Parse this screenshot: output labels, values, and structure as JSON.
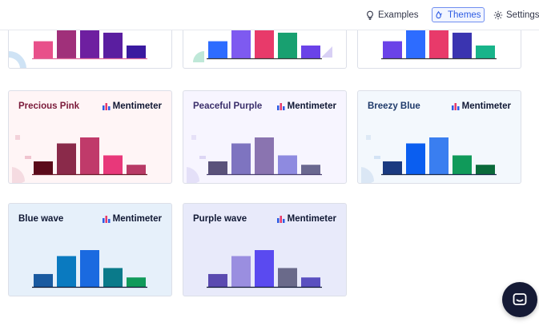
{
  "nav": {
    "examples_label": "Examples",
    "themes_label": "Themes",
    "settings_label": "Settings"
  },
  "brand_label": "Mentimeter",
  "colors": {
    "active_accent": "#2d5be3",
    "chat_button": "#151a35"
  },
  "themes": [
    {
      "id": "partial-1",
      "name": "",
      "bg": "#ffffff",
      "name_color": "#101834",
      "base_color": "#e06a9a",
      "bar_values": [
        2,
        6,
        6,
        3,
        1.5
      ],
      "bar_colors": [
        "#e8508a",
        "#a0307a",
        "#6e1fa0",
        "#5a1ea0",
        "#3a1aa0"
      ],
      "partial": true
    },
    {
      "id": "partial-2",
      "name": "",
      "bg": "#ffffff",
      "name_color": "#101834",
      "base_color": "#3a3a3a",
      "bar_values": [
        2,
        6,
        6,
        3,
        1.5
      ],
      "bar_colors": [
        "#2d6cff",
        "#7e5af0",
        "#e83a6a",
        "#18a070",
        "#6a42e8"
      ],
      "partial": true
    },
    {
      "id": "partial-3",
      "name": "",
      "bg": "#ffffff",
      "name_color": "#101834",
      "base_color": "#3a3a3a",
      "bar_values": [
        2,
        5.5,
        5.5,
        3,
        1.5
      ],
      "bar_colors": [
        "#6a42e8",
        "#2d6cff",
        "#e83a6a",
        "#3a34b0",
        "#18b48a"
      ],
      "partial": true
    },
    {
      "id": "precious-pink",
      "name": "Precious Pink",
      "bg": "#fff5f6",
      "name_color": "#7a1a3a",
      "base_color": "#6a1a2a",
      "bar_values": [
        1.5,
        3.6,
        4.3,
        2.2,
        1.1
      ],
      "bar_colors": [
        "#5a0a1a",
        "#8a2a4a",
        "#c03a6a",
        "#e8387a",
        "#b83a66"
      ]
    },
    {
      "id": "peaceful-purple",
      "name": "Peaceful Purple",
      "bg": "#f7f5ff",
      "name_color": "#3a2e6a",
      "base_color": "#4a4070",
      "bar_values": [
        1.5,
        3.6,
        4.3,
        2.2,
        1.1
      ],
      "bar_colors": [
        "#5a527a",
        "#7e74c0",
        "#8a74b0",
        "#8e8ae0",
        "#6a6890"
      ]
    },
    {
      "id": "breezy-blue",
      "name": "Breezy Blue",
      "bg": "#f3f8fd",
      "name_color": "#1f3a6a",
      "base_color": "#1a2a4a",
      "bar_values": [
        1.5,
        3.6,
        4.3,
        2.2,
        1.1
      ],
      "bar_colors": [
        "#1a3a80",
        "#0a5ef0",
        "#3a7ef0",
        "#109a5a",
        "#0a6a3a"
      ]
    },
    {
      "id": "blue-wave",
      "name": "Blue wave",
      "bg": "#e6f0fa",
      "name_color": "#101834",
      "base_color": "#101834",
      "bar_values": [
        1.5,
        3.6,
        4.3,
        2.2,
        1.1
      ],
      "bar_colors": [
        "#1a5aa0",
        "#0a7ac0",
        "#1a6ae0",
        "#0a7a8a",
        "#109a5a"
      ]
    },
    {
      "id": "purple-wave",
      "name": "Purple wave",
      "bg": "#e8eafa",
      "name_color": "#101834",
      "base_color": "#101834",
      "bar_values": [
        1.5,
        3.6,
        4.3,
        2.2,
        1.1
      ],
      "bar_colors": [
        "#5a4ab0",
        "#9a8ee0",
        "#5a4af0",
        "#6a6a8a",
        "#5a50c0"
      ]
    }
  ]
}
